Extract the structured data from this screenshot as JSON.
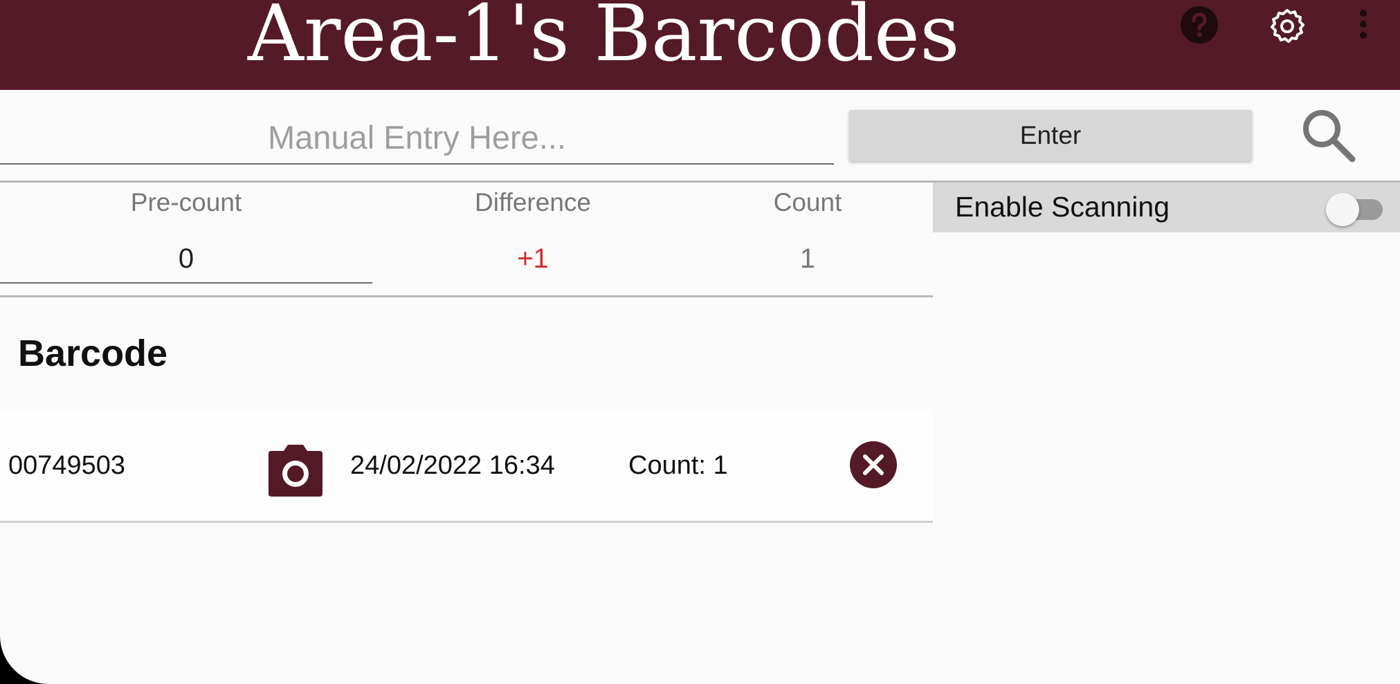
{
  "header": {
    "title": "Area-1's Barcodes",
    "background_color": "#541a28",
    "icons": [
      "help-icon",
      "settings-icon",
      "more-vertical-icon"
    ]
  },
  "manual_entry": {
    "placeholder": "Manual Entry Here...",
    "value": "",
    "enter_label": "Enter",
    "search_icon": "search-icon"
  },
  "counts": {
    "precount_label": "Pre-count",
    "precount_value": "0",
    "difference_label": "Difference",
    "difference_value": "+1",
    "difference_color": "#d32f2f",
    "count_label": "Count",
    "count_value": "1"
  },
  "scanning": {
    "label": "Enable Scanning",
    "enabled": false
  },
  "list": {
    "title": "Barcode",
    "items": [
      {
        "code": "00749503",
        "camera_icon": "camera-icon",
        "datetime": "24/02/2022 16:34",
        "count_text": "Count: 1",
        "delete_icon": "delete-icon"
      }
    ]
  }
}
